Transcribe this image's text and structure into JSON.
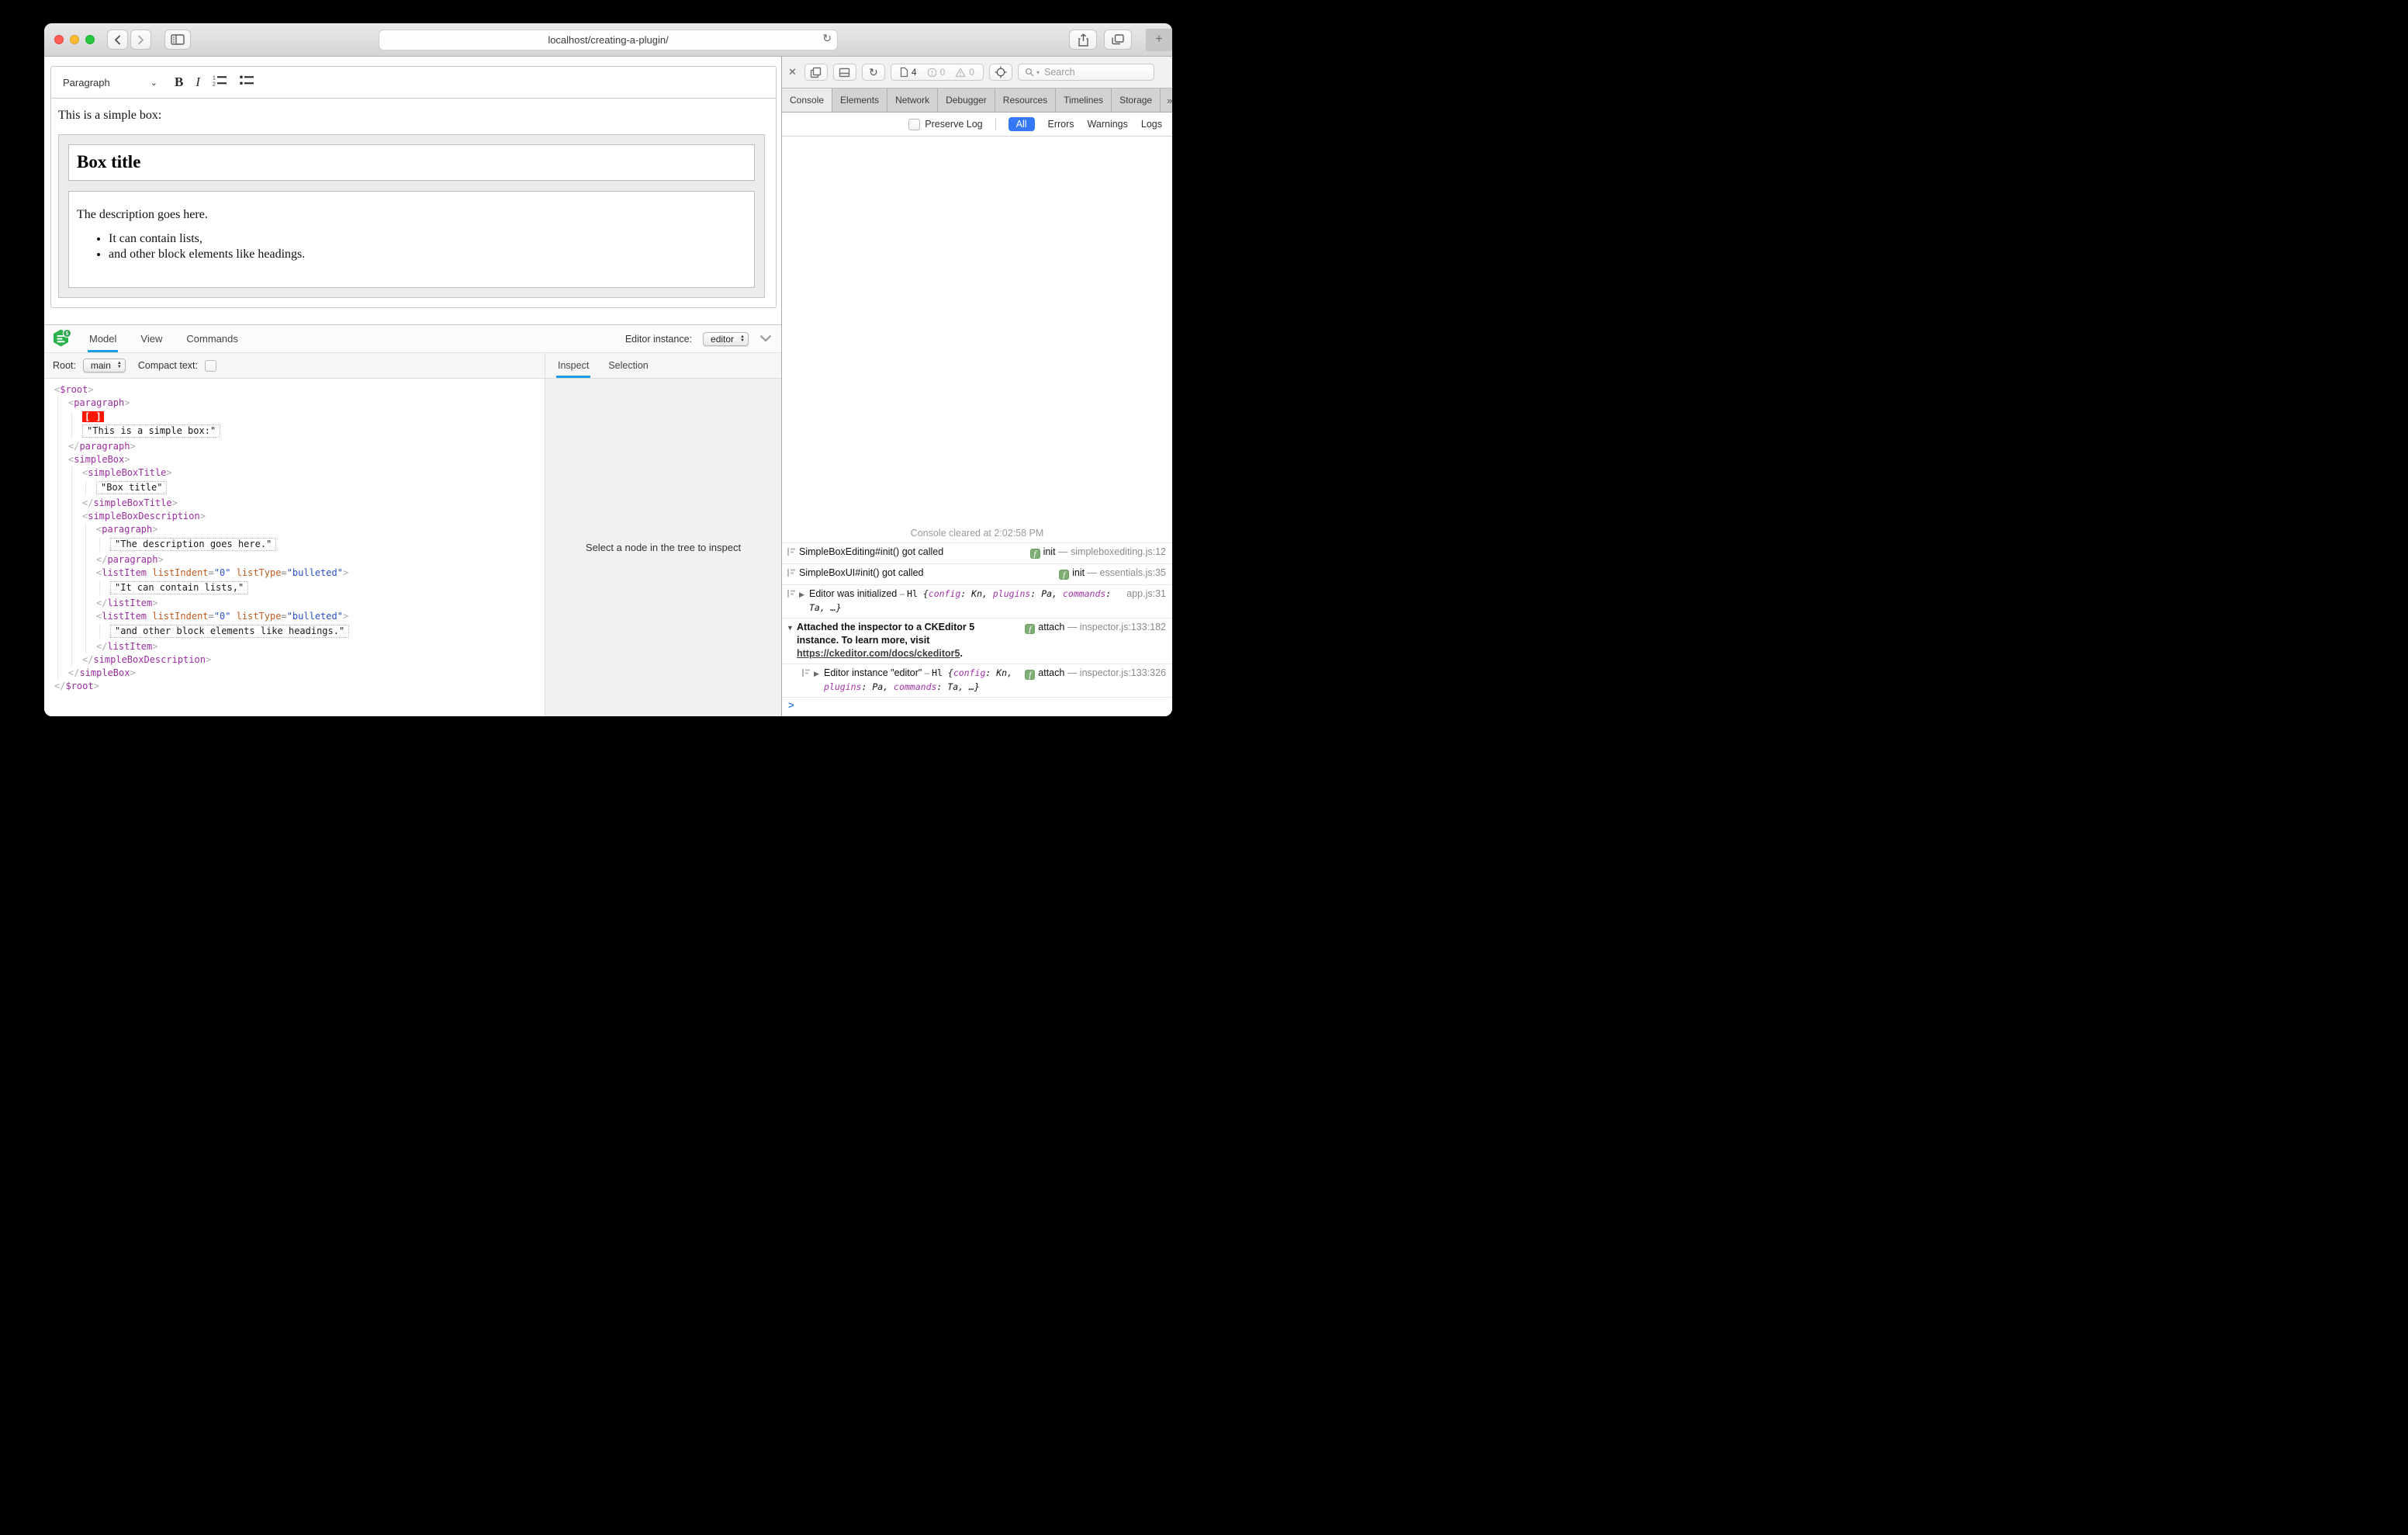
{
  "browser": {
    "url": "localhost/creating-a-plugin/"
  },
  "icons": {
    "back": "❮",
    "forward": "❯",
    "reload": "↻",
    "plus": "+",
    "close": "✕",
    "overflow": "»",
    "add": "+",
    "gear": "⚙",
    "collapse": "⌄",
    "disc_closed": "▶",
    "disc_open": "▼",
    "prompt": ">",
    "chevron_down": "⌄",
    "function_badge": "f",
    "bold": "B",
    "italic": "I"
  },
  "editor": {
    "toolbar": {
      "paragraph_label": "Paragraph"
    },
    "content": {
      "intro": "This is a simple box:",
      "box_title": "Box title",
      "description": "The description goes here.",
      "bullets": [
        "It can contain lists,",
        "and other block elements like headings."
      ]
    }
  },
  "inspector": {
    "tabs": [
      "Model",
      "View",
      "Commands"
    ],
    "active_tab": "Model",
    "editor_instance_label": "Editor instance:",
    "editor_instance_value": "editor",
    "root_label": "Root:",
    "root_value": "main",
    "compact_label": "Compact text:",
    "side_tabs": [
      "Inspect",
      "Selection"
    ],
    "side_active": "Inspect",
    "empty_message": "Select a node in the tree to inspect",
    "selection_marker": "[ ]",
    "tree": {
      "tag": "$root",
      "children": [
        {
          "tag": "paragraph",
          "children": [
            {
              "sel": true
            },
            {
              "text": "\"This is a simple box:\""
            }
          ]
        },
        {
          "tag": "simpleBox",
          "children": [
            {
              "tag": "simpleBoxTitle",
              "children": [
                {
                  "text": "\"Box title\""
                }
              ]
            },
            {
              "tag": "simpleBoxDescription",
              "children": [
                {
                  "tag": "paragraph",
                  "children": [
                    {
                      "text": "\"The description goes here.\""
                    }
                  ]
                },
                {
                  "tag": "listItem",
                  "attrs": [
                    [
                      "listIndent",
                      "0"
                    ],
                    [
                      "listType",
                      "bulleted"
                    ]
                  ],
                  "children": [
                    {
                      "text": "\"It can contain lists,\""
                    }
                  ]
                },
                {
                  "tag": "listItem",
                  "attrs": [
                    [
                      "listIndent",
                      "0"
                    ],
                    [
                      "listType",
                      "bulleted"
                    ]
                  ],
                  "children": [
                    {
                      "text": "\"and other block elements like headings.\""
                    }
                  ]
                }
              ]
            }
          ]
        }
      ]
    }
  },
  "devtools": {
    "toolbar": {
      "doc_count": "4",
      "error_count": "0",
      "warning_count": "0",
      "search_placeholder": "Search"
    },
    "tabs": [
      "Console",
      "Elements",
      "Network",
      "Debugger",
      "Resources",
      "Timelines",
      "Storage"
    ],
    "active_tab": "Console",
    "filters": {
      "preserve_log": "Preserve Log",
      "options": [
        "All",
        "Errors",
        "Warnings",
        "Logs"
      ],
      "active": "All"
    },
    "console": {
      "cleared": "Console cleared at 2:02:58 PM",
      "object_preview": {
        "dash": "–",
        "class_name": "Hl",
        "pairs": [
          [
            "config",
            "Kn"
          ],
          [
            "plugins",
            "Pa"
          ],
          [
            "commands",
            "Ta"
          ]
        ],
        "ellipsis": "…"
      },
      "rows": [
        {
          "text": "SimpleBoxEditing#init() got called",
          "icon": true,
          "badge": "init",
          "loc": "simpleboxediting.js:12"
        },
        {
          "text": "SimpleBoxUI#init() got called",
          "icon": true,
          "badge": "init",
          "loc": "essentials.js:35"
        },
        {
          "text": "Editor was initialized",
          "icon": true,
          "disc": "closed",
          "obj": true,
          "loc": "app.js:31"
        },
        {
          "text": "Attached the inspector to a CKEditor 5 instance. To learn more, visit ",
          "link": "https://ckeditor.com/docs/ckeditor5",
          "suffix": ".",
          "disc": "open",
          "bold": true,
          "badge": "attach",
          "loc": "inspector.js:133:182"
        },
        {
          "text": "Editor instance \"editor\"",
          "icon": true,
          "nested": true,
          "disc": "closed",
          "obj": true,
          "badge": "attach",
          "loc": "inspector.js:133:326"
        }
      ]
    }
  },
  "colors": {
    "accent_blue": "#3478f6",
    "inspector_blue": "#1b9de2",
    "ck_green": "#2bb24c",
    "tag_purple": "#9b2c9f",
    "attr_orange": "#bf5b1f",
    "value_blue": "#2d50c8",
    "selection_red": "#ff1500",
    "badge_green": "#7fae74"
  }
}
